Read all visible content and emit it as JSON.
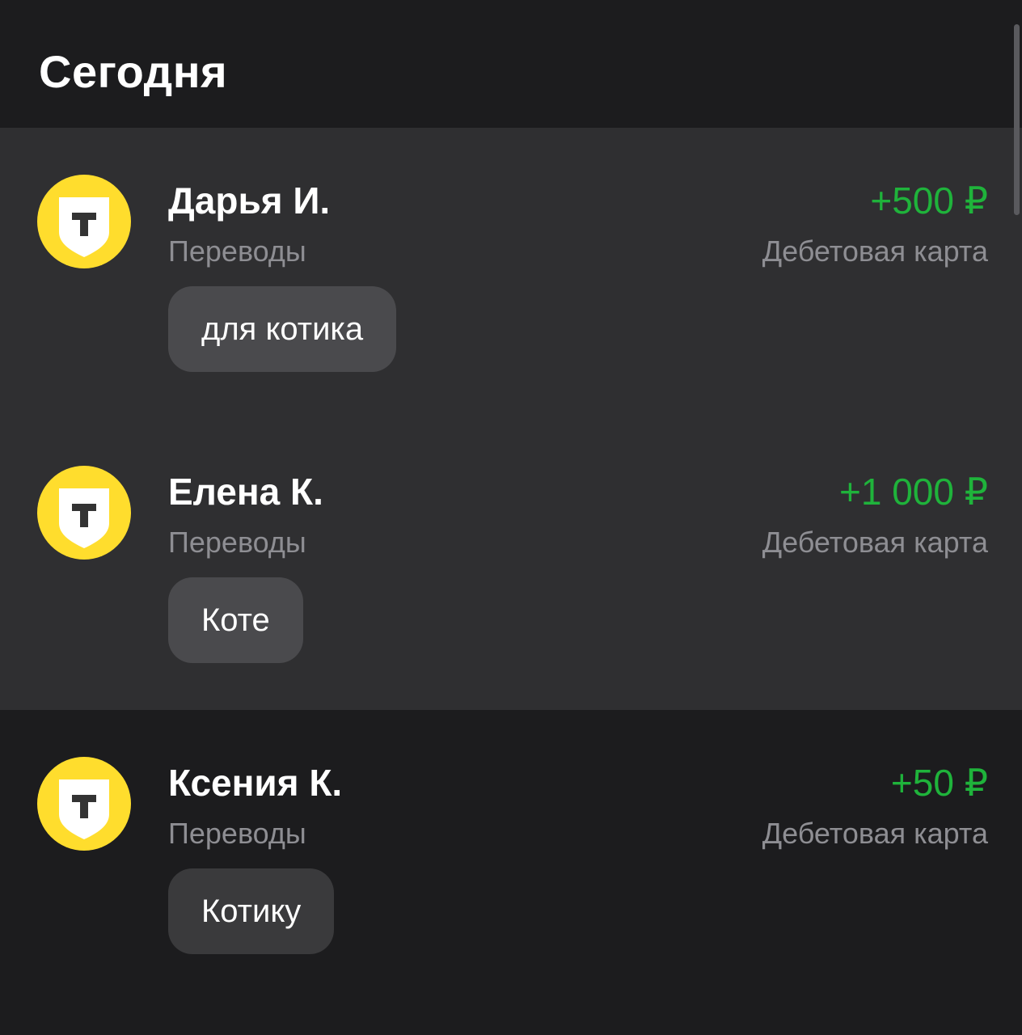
{
  "header": {
    "title": "Сегодня"
  },
  "transactions": [
    {
      "name": "Дарья И.",
      "category": "Переводы",
      "amount": "+500 ₽",
      "account": "Дебетовая карта",
      "comment": "для котика",
      "logo_icon": "tinkoff-shield-icon"
    },
    {
      "name": "Елена К.",
      "category": "Переводы",
      "amount": "+1 000 ₽",
      "account": "Дебетовая карта",
      "comment": "Коте",
      "logo_icon": "tinkoff-shield-icon"
    },
    {
      "name": "Ксения К.",
      "category": "Переводы",
      "amount": "+50 ₽",
      "account": "Дебетовая карта",
      "comment": "Котику",
      "logo_icon": "tinkoff-shield-icon"
    }
  ],
  "colors": {
    "background": "#1c1c1e",
    "highlight": "#2f2f31",
    "amount_positive": "#1fb33b",
    "secondary_text": "#8e8e93",
    "brand_yellow": "#ffdd2d"
  }
}
